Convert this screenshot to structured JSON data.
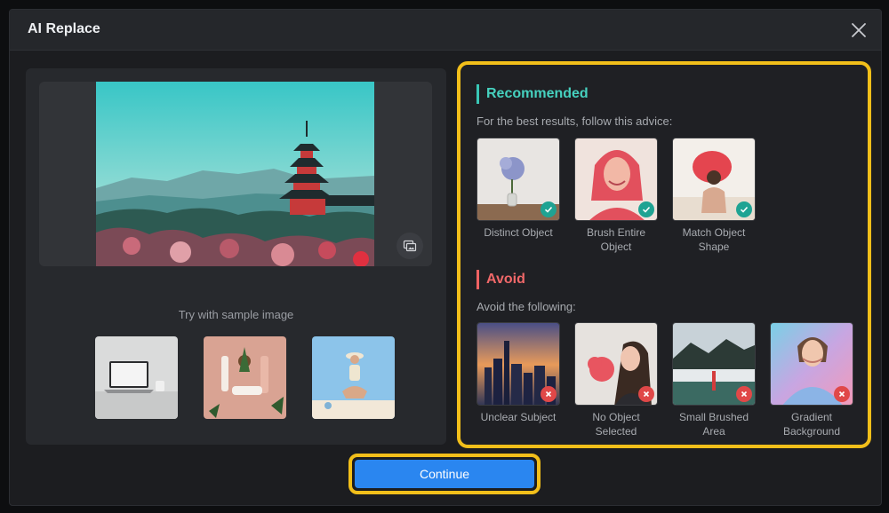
{
  "dialog": {
    "title": "AI Replace",
    "close_icon": "close-icon"
  },
  "preview": {
    "compare_icon": "image-compare-icon"
  },
  "samples": {
    "label": "Try with sample image",
    "items": [
      "laptop-sample",
      "cosmetics-sample",
      "beach-sample"
    ]
  },
  "recommended": {
    "heading": "Recommended",
    "subtitle": "For the best results, follow this advice:",
    "items": [
      {
        "caption": "Distinct Object"
      },
      {
        "caption": "Brush Entire Object"
      },
      {
        "caption": "Match Object Shape"
      }
    ]
  },
  "avoid": {
    "heading": "Avoid",
    "subtitle": "Avoid the following:",
    "items": [
      {
        "caption": "Unclear Subject"
      },
      {
        "caption": "No Object Selected"
      },
      {
        "caption": "Small Brushed Area"
      },
      {
        "caption": "Gradient Background"
      }
    ]
  },
  "actions": {
    "continue_label": "Continue"
  },
  "colors": {
    "accent": "#2a86f0",
    "recommended": "#46d1bf",
    "avoid": "#f06869",
    "highlight": "#f2bf1a"
  }
}
